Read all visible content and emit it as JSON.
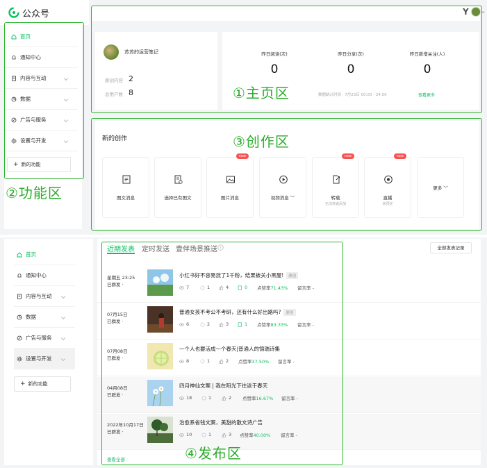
{
  "app": {
    "title": "公众号"
  },
  "sidebar": {
    "items": [
      {
        "label": "首页",
        "icon": "home-icon"
      },
      {
        "label": "通知中心",
        "icon": "bell-icon"
      },
      {
        "label": "内容与互动",
        "icon": "document-icon"
      },
      {
        "label": "数据",
        "icon": "chart-icon"
      },
      {
        "label": "广告与服务",
        "icon": "ad-icon"
      },
      {
        "label": "设置与开发",
        "icon": "gear-icon"
      }
    ],
    "new_function": "新的功能"
  },
  "header": {
    "logo_letter": "Y"
  },
  "profile": {
    "name": "苏苏的运营笔记",
    "stats": [
      {
        "label": "原创内容",
        "value": "2"
      },
      {
        "label": "总用户数",
        "value": "8"
      }
    ]
  },
  "overview": {
    "stats": [
      {
        "label": "昨日阅读(次)",
        "value": "0"
      },
      {
        "label": "昨日分享(次)",
        "value": "0"
      },
      {
        "label": "昨日新增关注(人)",
        "value": "0"
      }
    ],
    "data_time": "数据统计时间 · 7月23日 00:00 - 24:00",
    "view_more": "查看更多"
  },
  "creation": {
    "title": "新的创作",
    "tiles": [
      {
        "label": "图文消息",
        "sub": "",
        "badge": ""
      },
      {
        "label": "选择已有图文",
        "sub": "",
        "badge": ""
      },
      {
        "label": "图片消息",
        "sub": "",
        "badge": "new"
      },
      {
        "label": "视频消息 ﹀",
        "sub": "",
        "badge": ""
      },
      {
        "label": "转载",
        "sub": "无法快速添加",
        "badge": "new"
      },
      {
        "label": "直播",
        "sub": "未预定",
        "badge": "new"
      },
      {
        "label": "更多 ﹀",
        "sub": "",
        "badge": ""
      }
    ]
  },
  "annotations": {
    "home": "①主页区",
    "function": "②功能区",
    "create": "③创作区",
    "publish": "④发布区"
  },
  "publish": {
    "tabs": [
      "近期发表",
      "定时发送",
      "壹伴场景推送"
    ],
    "all_records": "全部发表记录",
    "view_all": "查看全部",
    "rows": [
      {
        "date": "星期五 23:25",
        "status": "已群发 ·",
        "title": "小红书好不容易涨了1千粉，结果被关小黑屋!",
        "tag": "原创",
        "views": "7",
        "shares": "1",
        "likes": "4",
        "extra": "0",
        "rate_label": "点赞率",
        "rate": "71.43%",
        "msg": "留言率 -"
      },
      {
        "date": "07月15日",
        "status": "已群发 ·",
        "title": "普通女孩不考公不考研，还有什么好出路吗?",
        "tag": "原创",
        "views": "6",
        "shares": "2",
        "likes": "3",
        "extra": "1",
        "rate_label": "点赞率",
        "rate": "83.33%",
        "msg": "留言率 -"
      },
      {
        "date": "07月08日",
        "status": "已群发 ·",
        "title": "一个人也要活成一个春天|普通人的锦瑞诗集",
        "tag": "",
        "views": "8",
        "shares": "1",
        "likes": "2",
        "extra": "",
        "rate_label": "点赞率",
        "rate": "37.50%",
        "msg": "留言率 -"
      },
      {
        "date": "04月08日",
        "status": "已群发 ·",
        "title": "四月神仙文案 | 我在阳光下往返于春天",
        "tag": "",
        "views": "18",
        "shares": "1",
        "likes": "2",
        "extra": "",
        "rate_label": "点赞率",
        "rate": "16.67%",
        "msg": "留言率 -"
      },
      {
        "date": "2022年10月17日",
        "status": "已群发 ·",
        "title": "治愈系省钱文案，美甜的散文诗广告",
        "tag": "",
        "views": "10",
        "shares": "1",
        "likes": "3",
        "extra": "",
        "rate_label": "点赞率",
        "rate": "40.00%",
        "msg": "留言率 -"
      }
    ]
  },
  "colors": {
    "accent": "#07c160",
    "annotation": "#2cac2c",
    "badge": "#fa5151"
  }
}
